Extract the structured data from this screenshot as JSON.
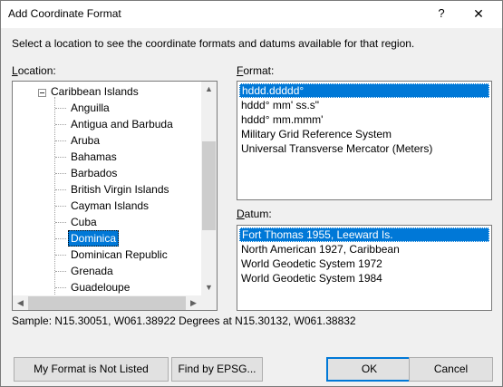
{
  "window": {
    "title": "Add Coordinate Format",
    "help_glyph": "?",
    "close_glyph": "✕"
  },
  "instructions": "Select a location to see the coordinate formats and datums available for that region.",
  "location": {
    "label_prefix": "L",
    "label_rest": "ocation:",
    "parent": "Caribbean Islands",
    "items": [
      "Anguilla",
      "Antigua and Barbuda",
      "Aruba",
      "Bahamas",
      "Barbados",
      "British Virgin Islands",
      "Cayman Islands",
      "Cuba",
      "Dominica",
      "Dominican Republic",
      "Grenada",
      "Guadeloupe"
    ],
    "selected": "Dominica"
  },
  "format": {
    "label_prefix": "F",
    "label_rest": "ormat:",
    "items": [
      "hddd.ddddd°",
      "hddd° mm' ss.s\"",
      "hddd° mm.mmm'",
      "Military Grid Reference System",
      "Universal Transverse Mercator (Meters)"
    ],
    "selected": "hddd.ddddd°"
  },
  "datum": {
    "label_prefix": "D",
    "label_rest": "atum:",
    "items": [
      "Fort Thomas 1955, Leeward Is.",
      "North American 1927, Caribbean",
      "World Geodetic System 1972",
      "World Geodetic System 1984"
    ],
    "selected": "Fort Thomas 1955, Leeward Is."
  },
  "sample": "Sample: N15.30051, W061.38922 Degrees at N15.30132, W061.38832",
  "buttons": {
    "not_listed": "My Format is Not Listed",
    "find_epsg": "Find by EPSG...",
    "ok": "OK",
    "cancel": "Cancel"
  },
  "scroll_arrows": {
    "up": "▲",
    "down": "▼",
    "left": "◀",
    "right": "▶"
  },
  "colors": {
    "selection": "#0078d7",
    "dialog_bg": "#f0f0f0"
  }
}
